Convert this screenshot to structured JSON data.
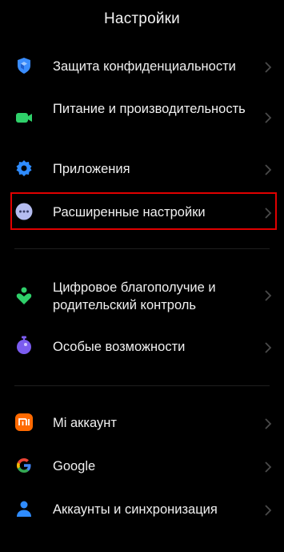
{
  "header": {
    "title": "Настройки"
  },
  "items": [
    {
      "label": "Защита конфиденциальности",
      "icon": "privacy-shield-icon"
    },
    {
      "label": "Питание и производительность",
      "icon": "battery-icon"
    },
    {
      "label": "Приложения",
      "icon": "gear-icon"
    },
    {
      "label": "Расширенные настройки",
      "icon": "more-dots-icon"
    },
    {
      "label": "Цифровое благополучие и родительский контроль",
      "icon": "digital-wellbeing-icon"
    },
    {
      "label": "Особые возможности",
      "icon": "accessibility-icon"
    },
    {
      "label": "Mi аккаунт",
      "icon": "mi-logo-icon"
    },
    {
      "label": "Google",
      "icon": "google-g-icon"
    },
    {
      "label": "Аккаунты и синхронизация",
      "icon": "account-person-icon"
    }
  ],
  "colors": {
    "background": "#000000",
    "text": "#f0f0f0",
    "chevron": "#4a4a4a",
    "highlight_border": "#e00000",
    "privacy_icon": "#3a8dff",
    "battery_icon": "#2fd06a",
    "gear_icon": "#2f8cff",
    "more_dots_bg": "#b5bcf0",
    "wellbeing_icon": "#2fd06a",
    "accessibility_icon": "#7b5cf0",
    "mi_logo": "#ff6a00",
    "account_icon": "#2f8cff"
  }
}
